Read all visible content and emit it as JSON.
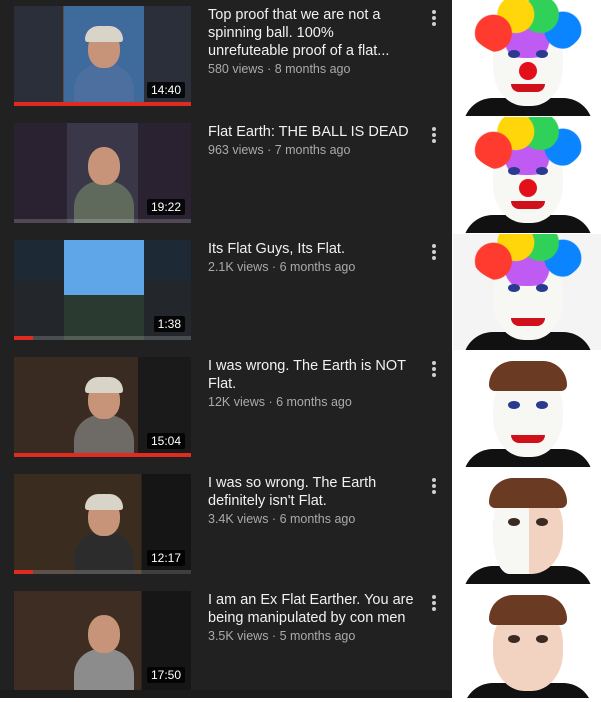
{
  "videos": [
    {
      "title": "Top proof that we are not a spinning ball. 100% unrefuteable proof of a flat...",
      "views": "580 views",
      "age": "8 months ago",
      "duration": "14:40",
      "watched": 1.0
    },
    {
      "title": "Flat Earth: THE BALL IS DEAD",
      "views": "963 views",
      "age": "7 months ago",
      "duration": "19:22",
      "watched": 0.0
    },
    {
      "title": "Its Flat Guys, Its Flat.",
      "views": "2.1K views",
      "age": "6 months ago",
      "duration": "1:38",
      "watched": 0.11
    },
    {
      "title": "I was wrong. The Earth is NOT Flat.",
      "views": "12K views",
      "age": "6 months ago",
      "duration": "15:04",
      "watched": 1.0
    },
    {
      "title": "I was so wrong. The Earth definitely isn't Flat.",
      "views": "3.4K views",
      "age": "6 months ago",
      "duration": "12:17",
      "watched": 0.11
    },
    {
      "title": "I am an Ex Flat Earther. You are being manipulated by con men",
      "views": "3.5K views",
      "age": "5 months ago",
      "duration": "17:50",
      "watched": 0.0
    }
  ],
  "meta_separator": " · ",
  "menu_icon": "more-vert-icon",
  "meme_panels": [
    "full-clown-makeup",
    "full-clown-makeup",
    "putting-on-wig",
    "applying-face-paint",
    "applying-white-base",
    "bare-face"
  ]
}
